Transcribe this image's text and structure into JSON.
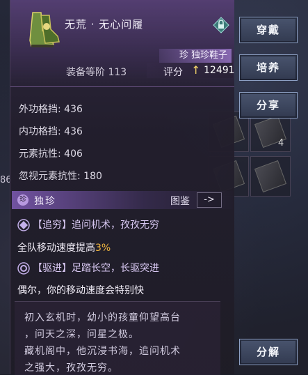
{
  "item": {
    "name": "无荒 · 无心问履",
    "rarity_tag": "珍 独珍鞋子",
    "gear_level": "装备等阶 113",
    "score_label": "评分",
    "score_value": "12491"
  },
  "stats": [
    {
      "text": "外功格挡: 436"
    },
    {
      "text": "内功格挡: 436"
    },
    {
      "text": "元素抗性: 406"
    },
    {
      "text": "忽视元素抗性: 180"
    }
  ],
  "rarity": {
    "badge": "珍",
    "name": "独珍",
    "atlas_label": "图鉴",
    "atlas_button": "->"
  },
  "skills": [
    {
      "title": "【追穷】追问机术，孜孜无穷",
      "desc_prefix": "全队移动速度提高",
      "desc_highlight": "3%",
      "icon": "diamond-skill-icon"
    },
    {
      "title": "【驱进】足踏长空，长驱突进",
      "desc_prefix": "偶尔，你的移动速度会特别快",
      "desc_highlight": "",
      "icon": "swirl-skill-icon"
    }
  ],
  "lore": [
    "初入玄机时，幼小的孩童仰望高台",
    "，问天之深，问星之极。",
    "藏机阁中，他沉浸书海，追问机术",
    "之强大，孜孜无穷。"
  ],
  "buttons": {
    "equip": "穿戴",
    "cultivate": "培养",
    "share": "分享",
    "dismantle": "分解"
  },
  "misc": {
    "left_number": "86",
    "slot_count": "4"
  },
  "colors": {
    "highlight": "#f0b640",
    "score_arrow": "#f3d46a",
    "rarity_purple": "#b89ae0"
  }
}
